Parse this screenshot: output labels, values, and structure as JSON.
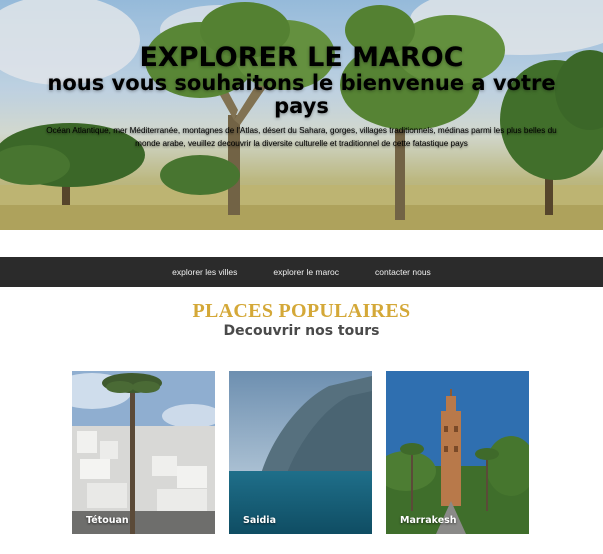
{
  "hero": {
    "title": "EXPLORER LE MAROC",
    "subtitle": "nous vous souhaitons le bienvenue a votre pays",
    "description": "Océan Atlantique, mer Méditerranée, montagnes de l'Atlas, désert du Sahara, gorges, villages traditionnels, médinas parmi les plus belles du monde arabe, veuillez decouvrir la diversite culturelle et traditionnel de cette fatastique pays"
  },
  "nav": {
    "items": [
      "explorer les villes",
      "explorer le maroc",
      "contacter nous"
    ]
  },
  "section": {
    "title": "PLACES POPULAIRES",
    "subtitle": "Decouvrir nos tours"
  },
  "cards": [
    {
      "label": "Tétouan"
    },
    {
      "label": "Saidia"
    },
    {
      "label": "Marrakesh"
    }
  ]
}
